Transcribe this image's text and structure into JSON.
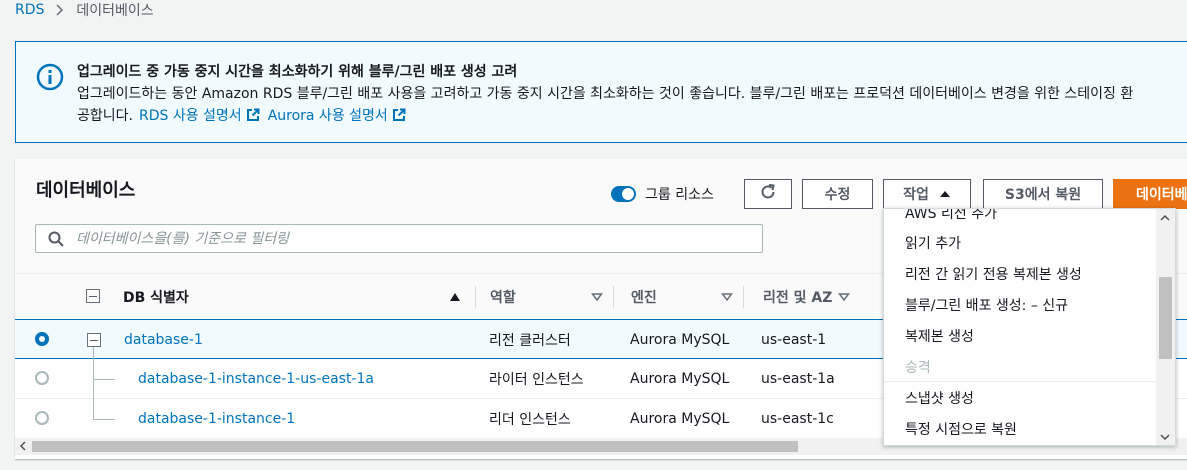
{
  "breadcrumb": {
    "root": "RDS",
    "current": "데이터베이스"
  },
  "info_banner": {
    "title": "업그레이드 중 가동 중지 시간을 최소화하기 위해 블루/그린 배포 생성 고려",
    "body_line1": "업그레이드하는 동안 Amazon RDS 블루/그린 배포 사용을 고려하고 가동 중지 시간을 최소화하는 것이 좋습니다. 블루/그린 배포는 프로덕션 데이터베이스 변경을 위한 스테이징 환",
    "body_line2": "공합니다.",
    "link_rds": "RDS 사용 설명서",
    "link_aurora": "Aurora 사용 설명서"
  },
  "panel": {
    "title": "데이터베이스",
    "group_toggle_label": "그룹 리소스",
    "group_toggle_on": true,
    "buttons": {
      "edit": "수정",
      "actions": "작업",
      "restore_s3": "S3에서 복원",
      "create": "데이터베"
    },
    "filter_placeholder": "데이터베이스을(를) 기준으로 필터링"
  },
  "table": {
    "columns": {
      "db_identifier": "DB 식별자",
      "role": "역할",
      "engine": "엔진",
      "region_az": "리전 및 AZ"
    },
    "rows": [
      {
        "id": "database-1",
        "role": "리전 클러스터",
        "engine": "Aurora MySQL",
        "region": "us-east-1",
        "selected": true
      },
      {
        "id": "database-1-instance-1-us-east-1a",
        "role": "라이터 인스턴스",
        "engine": "Aurora MySQL",
        "region": "us-east-1a",
        "selected": false
      },
      {
        "id": "database-1-instance-1",
        "role": "리더 인스턴스",
        "engine": "Aurora MySQL",
        "region": "us-east-1c",
        "selected": false
      }
    ]
  },
  "actions_menu": {
    "items": [
      {
        "label": "AWS 리전 추가",
        "disabled": false
      },
      {
        "label": "읽기 추가",
        "disabled": false
      },
      {
        "label": "리전 간 읽기 전용 복제본 생성",
        "disabled": false
      },
      {
        "label": "블루/그린 배포 생성: – 신규",
        "disabled": false
      },
      {
        "label": "복제본 생성",
        "disabled": false
      },
      {
        "label": "승격",
        "disabled": true
      },
      {
        "label": "스냅샷 생성",
        "disabled": false
      },
      {
        "label": "특정 시점으로 복원",
        "disabled": false
      }
    ]
  },
  "colors": {
    "link": "#0073bb",
    "primary_button": "#ec7211",
    "selected_row": "#f1faff"
  }
}
